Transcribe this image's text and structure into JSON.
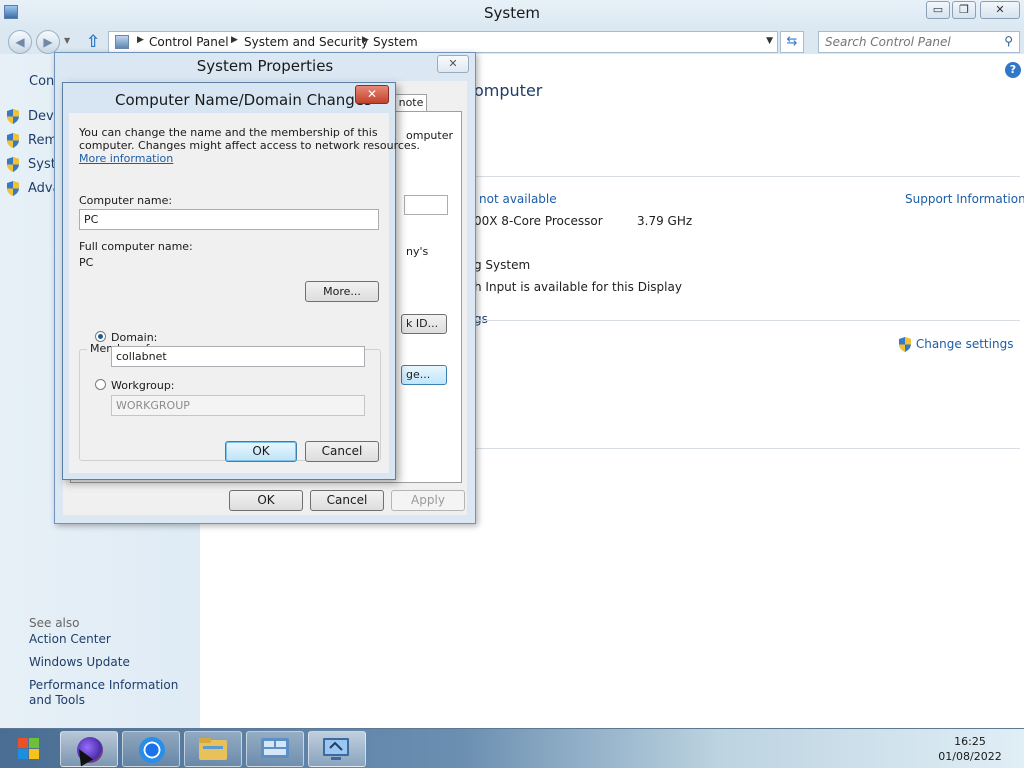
{
  "window": {
    "title": "System",
    "minimize": "▭",
    "maximize": "❐",
    "close": "✕"
  },
  "toolbar": {
    "back": "◀",
    "forward": "▶",
    "breadcrumbs": [
      "Control Panel",
      "System and Security",
      "System"
    ],
    "search_placeholder": "Search Control Panel"
  },
  "sidebar": {
    "header": "Cont",
    "items": [
      {
        "label": "Devic",
        "icon": "shield-icon"
      },
      {
        "label": "Remo",
        "icon": "shield-icon"
      },
      {
        "label": "Syste",
        "icon": "shield-icon"
      },
      {
        "label": "Adva",
        "icon": "shield-icon"
      }
    ],
    "see_also_title": "See also",
    "see_also": [
      "Action Center",
      "Windows Update",
      "Performance Information and Tools"
    ]
  },
  "main": {
    "heading_fragment": "omputer",
    "rating_fragment": "not available",
    "support_link": "Support Information",
    "processor_fragment": "00X 8-Core Processor",
    "processor_speed": "3.79 GHz",
    "system_type_fragment": "g System",
    "pen_touch_fragment": "h Input is available for this Display",
    "settings_fragment": "gs",
    "change_settings": "Change settings"
  },
  "system_properties": {
    "title": "System Properties",
    "close": "✕",
    "tab_fragment": "note",
    "fragments": {
      "computer": "omputer",
      "account": "ny's",
      "network_id": "k ID...",
      "change": "ge..."
    },
    "buttons": {
      "ok": "OK",
      "cancel": "Cancel",
      "apply": "Apply"
    }
  },
  "computer_name_dialog": {
    "title": "Computer Name/Domain Changes",
    "close": "✕",
    "description_line1": "You can change the name and the membership of this",
    "description_line2": "computer. Changes might affect access to network resources.",
    "more_info_link": "More information",
    "computer_name_label": "Computer name:",
    "computer_name_value": "PC",
    "full_name_label": "Full computer name:",
    "full_name_value": "PC",
    "more_button": "More...",
    "member_of_label": "Member of",
    "domain_label": "Domain:",
    "domain_value": "collabnet",
    "domain_selected": true,
    "workgroup_label": "Workgroup:",
    "workgroup_value": "WORKGROUP",
    "ok_button": "OK",
    "cancel_button": "Cancel"
  },
  "taskbar": {
    "time": "16:25",
    "date": "01/08/2022"
  },
  "colors": {
    "link": "#1c5da8",
    "nav_text": "#1e3e6a",
    "close_red": "#c4412b",
    "accent_blue": "#2f78c8"
  }
}
